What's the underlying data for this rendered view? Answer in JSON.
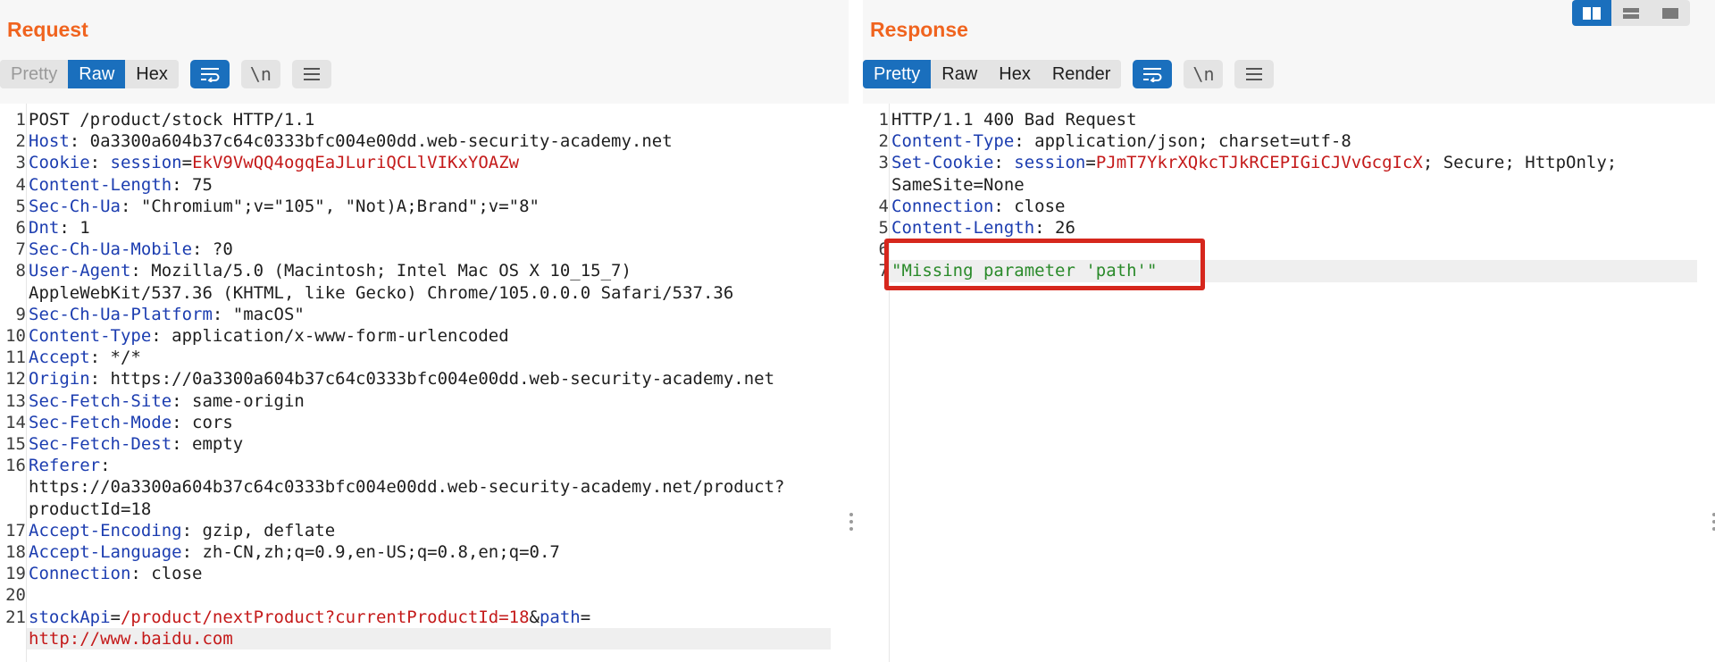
{
  "request": {
    "title": "Request",
    "view_tabs": [
      "Pretty",
      "Raw",
      "Hex"
    ],
    "active_tab": "Raw",
    "icons": [
      "wrap-icon",
      "newline-icon",
      "menu-icon"
    ],
    "newline_label": "\\n",
    "lines": [
      {
        "n": "1",
        "k": "",
        "v": "POST /product/stock HTTP/1.1"
      },
      {
        "n": "2",
        "k": "Host",
        "v": ": 0a3300a604b37c64c0333bfc004e00dd.web-security-academy.net"
      },
      {
        "n": "3",
        "k": "Cookie",
        "v": ": ",
        "ck": "session",
        "cv": "EkV9VwQQ4ogqEaJLuriQCLlVIKxYOAZw"
      },
      {
        "n": "4",
        "k": "Content-Length",
        "v": ": 75"
      },
      {
        "n": "5",
        "k": "Sec-Ch-Ua",
        "v": ": \"Chromium\";v=\"105\", \"Not)A;Brand\";v=\"8\""
      },
      {
        "n": "6",
        "k": "Dnt",
        "v": ": 1"
      },
      {
        "n": "7",
        "k": "Sec-Ch-Ua-Mobile",
        "v": ": ?0"
      },
      {
        "n": "8",
        "k": "User-Agent",
        "v": ": Mozilla/5.0 (Macintosh; Intel Mac OS X 10_15_7)"
      },
      {
        "n": "",
        "k": "",
        "v": "AppleWebKit/537.36 (KHTML, like Gecko) Chrome/105.0.0.0 Safari/537.36"
      },
      {
        "n": "9",
        "k": "Sec-Ch-Ua-Platform",
        "v": ": \"macOS\""
      },
      {
        "n": "10",
        "k": "Content-Type",
        "v": ": application/x-www-form-urlencoded"
      },
      {
        "n": "11",
        "k": "Accept",
        "v": ": */*"
      },
      {
        "n": "12",
        "k": "Origin",
        "v": ": https://0a3300a604b37c64c0333bfc004e00dd.web-security-academy.net"
      },
      {
        "n": "13",
        "k": "Sec-Fetch-Site",
        "v": ": same-origin"
      },
      {
        "n": "14",
        "k": "Sec-Fetch-Mode",
        "v": ": cors"
      },
      {
        "n": "15",
        "k": "Sec-Fetch-Dest",
        "v": ": empty"
      },
      {
        "n": "16",
        "k": "Referer",
        "v": ":"
      },
      {
        "n": "",
        "k": "",
        "v": "https://0a3300a604b37c64c0333bfc004e00dd.web-security-academy.net/product?"
      },
      {
        "n": "",
        "k": "",
        "v": "productId=18"
      },
      {
        "n": "17",
        "k": "Accept-Encoding",
        "v": ": gzip, deflate"
      },
      {
        "n": "18",
        "k": "Accept-Language",
        "v": ": zh-CN,zh;q=0.9,en-US;q=0.8,en;q=0.7"
      },
      {
        "n": "19",
        "k": "Connection",
        "v": ": close"
      },
      {
        "n": "20",
        "k": "",
        "v": ""
      },
      {
        "n": "21",
        "body": [
          {
            "t": "stockApi",
            "c": "hk"
          },
          {
            "t": "=",
            "c": ""
          },
          {
            "t": "/product/nextProduct?currentProductId=18",
            "c": "cv"
          },
          {
            "t": "&",
            "c": ""
          },
          {
            "t": "path",
            "c": "hk"
          },
          {
            "t": "=",
            "c": ""
          }
        ]
      },
      {
        "n": "",
        "body": [
          {
            "t": "http://www.baidu.com",
            "c": "cv"
          }
        ],
        "highlight": true
      }
    ]
  },
  "response": {
    "title": "Response",
    "view_tabs": [
      "Pretty",
      "Raw",
      "Hex",
      "Render"
    ],
    "active_tab": "Pretty",
    "icons": [
      "wrap-icon",
      "newline-icon",
      "menu-icon"
    ],
    "newline_label": "\\n",
    "lines": [
      {
        "n": "1",
        "k": "",
        "v": "HTTP/1.1 400 Bad Request"
      },
      {
        "n": "2",
        "k": "Content-Type",
        "v": ": application/json; charset=utf-8"
      },
      {
        "n": "3",
        "k": "Set-Cookie",
        "v": ": ",
        "ck": "session",
        "cv": "PJmT7YkrXQkcTJkRCEPIGiCJVvGcgIcX",
        "tail": "; Secure; HttpOnly;"
      },
      {
        "n": "",
        "k": "",
        "v": "SameSite=None"
      },
      {
        "n": "4",
        "k": "Connection",
        "v": ": close"
      },
      {
        "n": "5",
        "k": "Content-Length",
        "v": ": 26"
      },
      {
        "n": "6",
        "k": "",
        "v": ""
      },
      {
        "n": "7",
        "body": [
          {
            "t": "\"Missing parameter 'path'\"",
            "c": "str"
          }
        ],
        "highlight": true
      }
    ]
  },
  "layout_toggle": [
    "split-horizontal-icon",
    "split-vertical-icon",
    "single-pane-icon"
  ],
  "annotation_color": "#d6271d",
  "accent_color": "#1a6fbd",
  "title_color": "#f0641f"
}
